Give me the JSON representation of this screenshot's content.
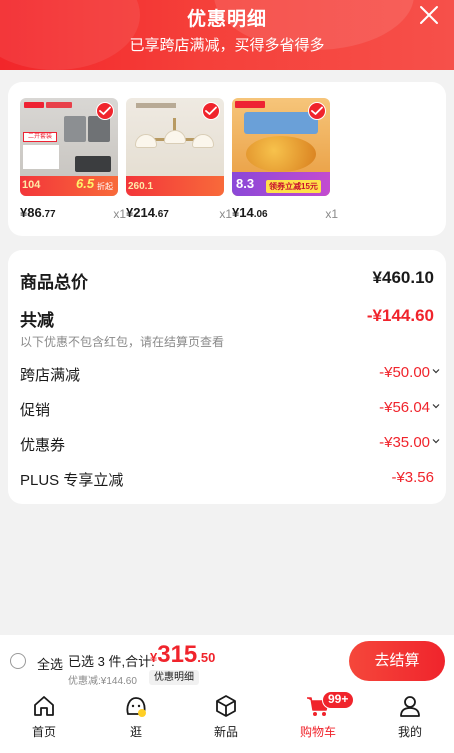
{
  "header": {
    "title": "优惠明细",
    "subtitle": "已享跨店满减，买得多省得多",
    "close_icon": "close-icon"
  },
  "products": [
    {
      "price_int": "¥86",
      "price_dec": ".77",
      "qty": "x1",
      "thumb_text_top": "二开套装",
      "thumb_price": "104",
      "thumb_tag": "折起",
      "thumb_discount": "6.5"
    },
    {
      "price_int": "¥214",
      "price_dec": ".67",
      "qty": "x1",
      "thumb_price": "260.1"
    },
    {
      "price_int": "¥14",
      "price_dec": ".06",
      "qty": "x1",
      "thumb_price": "8.3",
      "thumb_tag": "领券立减15元"
    }
  ],
  "summary": {
    "total_label": "商品总价",
    "total_value": "¥460.10",
    "reduce_label": "共减",
    "reduce_value": "-¥144.60",
    "note": "以下优惠不包含红包，请在结算页查看",
    "items": [
      {
        "label": "跨店满减",
        "value": "-¥50.00",
        "expandable": true
      },
      {
        "label": "促销",
        "value": "-¥56.04",
        "expandable": true
      },
      {
        "label": "优惠券",
        "value": "-¥35.00",
        "expandable": true
      },
      {
        "label": "PLUS 专享立减",
        "value": "-¥3.56",
        "expandable": false
      }
    ]
  },
  "checkout": {
    "select_all": "全选",
    "selected_text": "已选 3 件,合计:",
    "total_currency": "¥",
    "total_int": "315",
    "total_dec": ".50",
    "discount_line": "优惠减:¥144.60",
    "detail_label": "优惠明细",
    "pay_label": "去结算"
  },
  "tabbar": {
    "tabs": [
      {
        "label": "首页",
        "icon": "home-icon"
      },
      {
        "label": "逛",
        "icon": "browse-icon"
      },
      {
        "label": "新品",
        "icon": "new-product-icon"
      },
      {
        "label": "购物车",
        "icon": "cart-icon",
        "active": true
      },
      {
        "label": "我的",
        "icon": "profile-icon"
      }
    ],
    "cart_badge": "99+"
  },
  "colors": {
    "accent": "#f0242c",
    "header_bg": "#f4363a",
    "page_bg": "#f2f2f2"
  }
}
